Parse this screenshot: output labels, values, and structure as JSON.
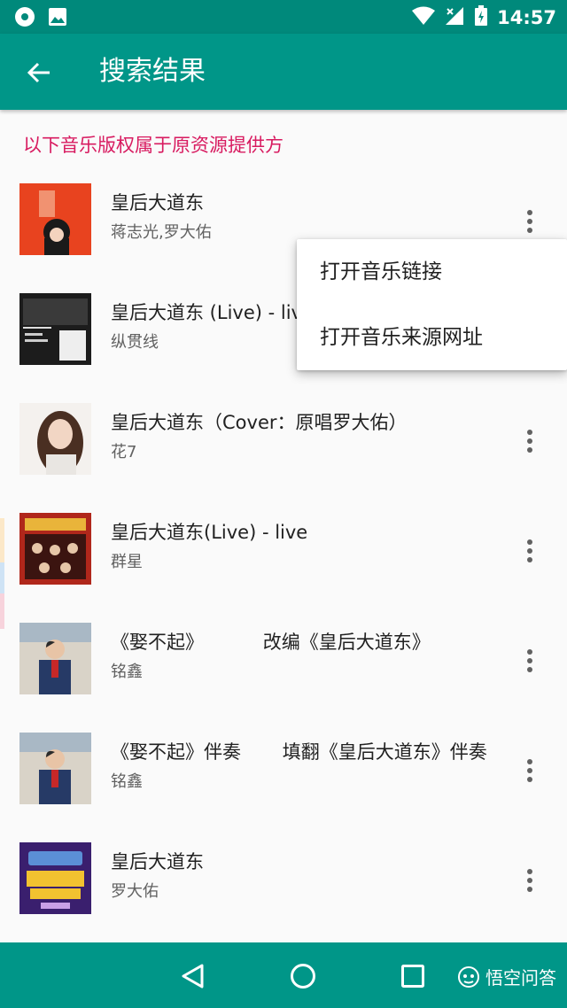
{
  "status_bar": {
    "time": "14:57",
    "icons": [
      "disc-icon",
      "image-icon",
      "wifi-icon",
      "signal-icon",
      "battery-icon"
    ]
  },
  "app_bar": {
    "title": "搜索结果",
    "back_icon": "arrow-back-icon"
  },
  "notice": "以下音乐版权属于原资源提供方",
  "results": [
    {
      "title": "皇后大道东",
      "artist": "蒋志光,罗大佑"
    },
    {
      "title": "皇后大道东 (Live) - live",
      "artist": "纵贯线"
    },
    {
      "title": "皇后大道东（Cover：原唱罗大佑）",
      "artist": "花7"
    },
    {
      "title": "皇后大道东(Live) - live",
      "artist": "群星"
    },
    {
      "title": "《娶不起》          改编《皇后大道东》",
      "artist": "铭鑫"
    },
    {
      "title": "《娶不起》伴奏       填翻《皇后大道东》伴奏",
      "artist": "铭鑫"
    },
    {
      "title": "皇后大道东",
      "artist": "罗大佑"
    }
  ],
  "context_menu": {
    "items": [
      "打开音乐链接",
      "打开音乐来源网址"
    ]
  },
  "watermark": {
    "text": "悟空问答"
  },
  "colors": {
    "primary": "#009688",
    "primary_dark": "#00897b",
    "accent": "#d81b60"
  }
}
